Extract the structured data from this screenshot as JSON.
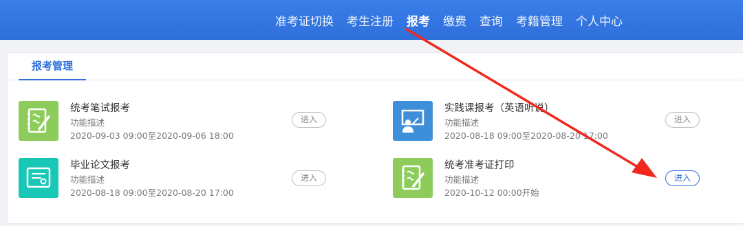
{
  "nav": {
    "items": [
      "准考证切换",
      "考生注册",
      "报考",
      "缴费",
      "查询",
      "考籍管理",
      "个人中心"
    ],
    "active_index": 2
  },
  "tab": {
    "label": "报考管理"
  },
  "cards": [
    {
      "title": "统考笔试报考",
      "desc": "功能描述",
      "time": "2020-09-03 09:00至2020-09-06 18:00",
      "button": "进入",
      "icon": "notebook-pen-icon",
      "color": "#8dcc5a"
    },
    {
      "title": "实践课报考（英语听说）",
      "desc": "功能描述",
      "time": "2020-08-18 09:00至2020-08-20 17:00",
      "button": "进入",
      "icon": "presentation-board-icon",
      "color": "#3d8fd9"
    },
    {
      "title": "毕业论文报考",
      "desc": "功能描述",
      "time": "2020-08-18 09:00至2020-08-20 17:00",
      "button": "进入",
      "icon": "certificate-icon",
      "color": "#18c7b6"
    },
    {
      "title": "统考准考证打印",
      "desc": "功能描述",
      "time": "2020-10-12 00:00开始",
      "button": "进入",
      "icon": "notebook-pen-icon",
      "color": "#8dcc5a"
    }
  ],
  "annotation": {
    "arrow_color": "#f0281e"
  }
}
